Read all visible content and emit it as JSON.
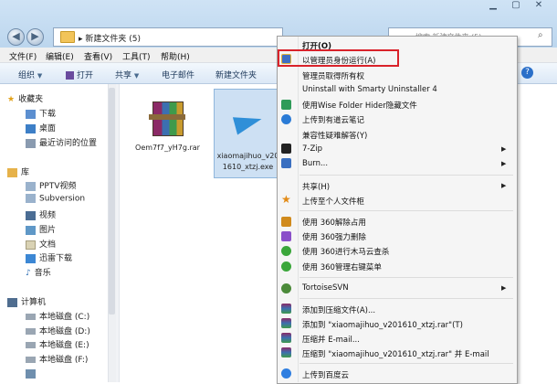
{
  "address": {
    "path": "新建文件夹 (5)",
    "search_placeholder": "搜索 新建文件夹 (5)"
  },
  "menubar": [
    "文件(F)",
    "编辑(E)",
    "查看(V)",
    "工具(T)",
    "帮助(H)"
  ],
  "toolbar": {
    "organize": "组织",
    "open": "打开",
    "share": "共享",
    "email": "电子邮件",
    "new_folder": "新建文件夹"
  },
  "nav": {
    "favorites": {
      "label": "收藏夹",
      "items": [
        "下载",
        "桌面",
        "最近访问的位置"
      ]
    },
    "libraries": {
      "label": "库",
      "items": [
        "PPTV视频",
        "Subversion",
        "视频",
        "图片",
        "文档",
        "迅雷下载",
        "音乐"
      ]
    },
    "computer": {
      "label": "计算机",
      "items": [
        "本地磁盘 (C:)",
        "本地磁盘 (D:)",
        "本地磁盘 (E:)",
        "本地磁盘 (F:)"
      ]
    }
  },
  "files": [
    {
      "name": "Oem7f7_yH7g.rar"
    },
    {
      "name": "xiaomajihuo_v201610_xtzj.exe",
      "line1": "xiaomajihuo_v20",
      "line2": "1610_xtzj.exe"
    }
  ],
  "context_menu": {
    "open": "打开(O)",
    "run_as_admin": "以管理员身份运行(A)",
    "take_ownership": "管理员取得所有权",
    "uninstall": "Uninstall with Smarty Uninstaller 4",
    "wise_folder": "使用Wise Folder Hider隐藏文件",
    "youdao": "上传到有道云笔记",
    "compat": "兼容性疑难解答(Y)",
    "sevenzip": "7-Zip",
    "burn": "Burn...",
    "share_with": "共享(H)",
    "upload_personal": "上传至个人文件柜",
    "unlock360": "使用 360解除占用",
    "delete360": "使用 360强力删除",
    "scan360": "使用 360进行木马云查杀",
    "manage360": "使用 360管理右键菜单",
    "tortoise": "TortoiseSVN",
    "add_archive": "添加到压缩文件(A)...",
    "add_rar": "添加到 \"xiaomajihuo_v201610_xtzj.rar\"(T)",
    "compress_email": "压缩并 E-mail...",
    "compress_rar_email": "压缩到 \"xiaomajihuo_v201610_xtzj.rar\" 并 E-mail",
    "baidu": "上传到百度云"
  },
  "colors": {
    "highlight_border": "#d9222a",
    "toolbar_bg": "#dbe8f6",
    "selection": "#cde0f3"
  }
}
